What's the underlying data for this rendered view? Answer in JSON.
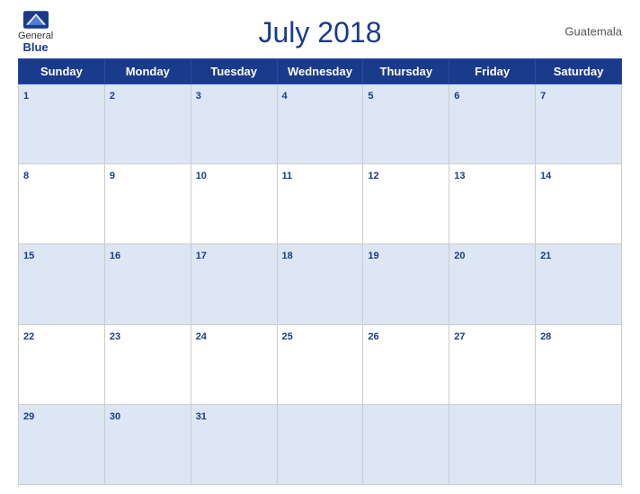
{
  "header": {
    "logo_general": "General",
    "logo_blue": "Blue",
    "title": "July 2018",
    "country": "Guatemala"
  },
  "days_of_week": [
    "Sunday",
    "Monday",
    "Tuesday",
    "Wednesday",
    "Thursday",
    "Friday",
    "Saturday"
  ],
  "weeks": [
    [
      1,
      2,
      3,
      4,
      5,
      6,
      7
    ],
    [
      8,
      9,
      10,
      11,
      12,
      13,
      14
    ],
    [
      15,
      16,
      17,
      18,
      19,
      20,
      21
    ],
    [
      22,
      23,
      24,
      25,
      26,
      27,
      28
    ],
    [
      29,
      30,
      31,
      null,
      null,
      null,
      null
    ]
  ]
}
